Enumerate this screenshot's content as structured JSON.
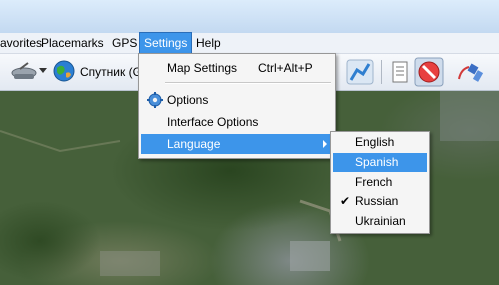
{
  "menubar": {
    "items": [
      {
        "label": "avorites"
      },
      {
        "label": "Placemarks"
      },
      {
        "label": "GPS"
      },
      {
        "label": "Settings",
        "active": true
      },
      {
        "label": "Help"
      }
    ]
  },
  "toolbar": {
    "map_source_label": "Спутник (G",
    "icons": [
      "satellite-dish-icon",
      "dropdown-arrow-icon",
      "globe-icon",
      "route-icon",
      "notebook-icon",
      "no-entry-icon",
      "gps-satellite-icon"
    ]
  },
  "settings_menu": {
    "items": [
      {
        "label": "Map Settings",
        "shortcut": "Ctrl+Alt+P"
      },
      {
        "label": "Options",
        "icon": "gear-icon"
      },
      {
        "label": "Interface Options"
      },
      {
        "label": "Language",
        "has_submenu": true,
        "highlighted": true
      }
    ]
  },
  "language_menu": {
    "items": [
      {
        "label": "English"
      },
      {
        "label": "Spanish",
        "highlighted": true
      },
      {
        "label": "French"
      },
      {
        "label": "Russian",
        "checked": true
      },
      {
        "label": "Ukrainian"
      }
    ]
  },
  "colors": {
    "highlight": "#3d95ea",
    "menu_bg": "#f5f5f5"
  }
}
